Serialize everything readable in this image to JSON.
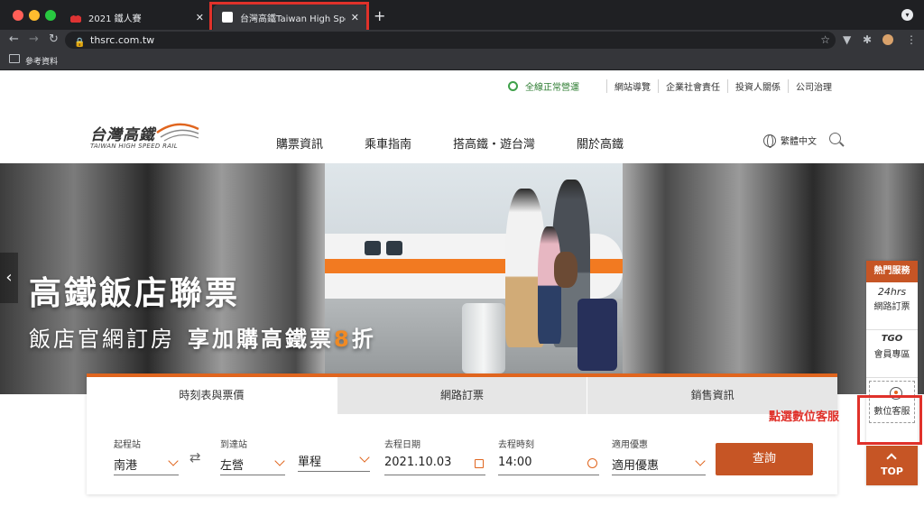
{
  "browser": {
    "tabs": [
      {
        "title": "2021 鐵人賽",
        "active": false
      },
      {
        "title": "台灣高鐵Taiwan High Speed Ra",
        "active": true
      }
    ],
    "url": "thsrc.com.tw",
    "bookmark": "參考資料"
  },
  "site": {
    "status": "全線正常營運",
    "toplinks": [
      "網站導覽",
      "企業社會責任",
      "投資人關係",
      "公司治理"
    ],
    "logo_cn": "台灣高鐵",
    "logo_en": "TAIWAN HIGH SPEED RAIL",
    "nav": [
      "購票資訊",
      "乘車指南",
      "搭高鐵・遊台灣",
      "關於高鐵"
    ],
    "language": "繁體中文"
  },
  "hero": {
    "title": "高鐵飯店聯票",
    "sub_part1": "飯店官網訂房",
    "sub_part2": "享加購高鐵票",
    "sub_num": "8",
    "sub_part3": "折"
  },
  "booking": {
    "tabs": [
      "時刻表與票價",
      "網路訂票",
      "銷售資訊"
    ],
    "fields": [
      {
        "label": "起程站",
        "value": "南港"
      },
      {
        "label": "到達站",
        "value": "左營"
      },
      {
        "label": "",
        "value": "單程"
      },
      {
        "label": "去程日期",
        "value": "2021.10.03"
      },
      {
        "label": "去程時刻",
        "value": "14:00"
      },
      {
        "label": "適用優惠",
        "value": "適用優惠"
      }
    ],
    "submit": "查詢"
  },
  "services": {
    "head": "熱門服務",
    "items": [
      {
        "icon_text": "24hrs",
        "label": "網路訂票"
      },
      {
        "icon_text": "TGO",
        "label": "會員專區"
      },
      {
        "icon_text": "",
        "label": "數位客服"
      }
    ],
    "top": "TOP"
  },
  "annotation": "點選數位客服",
  "colors": {
    "accent": "#c65525",
    "highlight": "#e0312a",
    "status_green": "#3fa14a"
  }
}
